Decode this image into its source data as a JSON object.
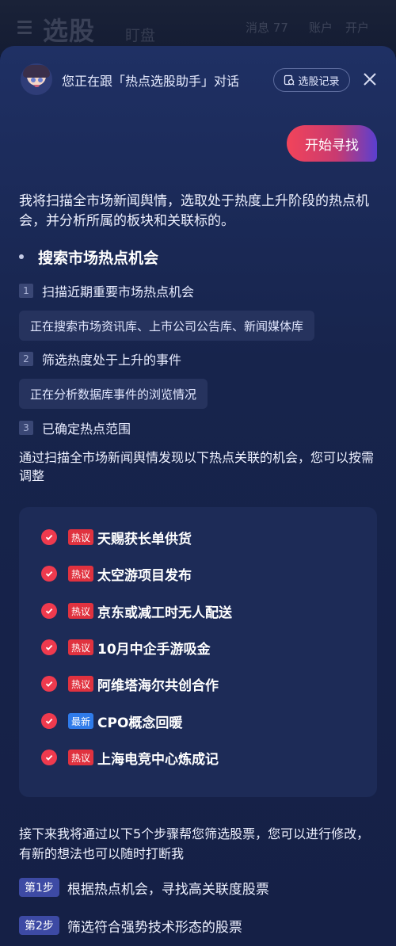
{
  "background_app": {
    "title": "选股",
    "subtitle": "盯盘",
    "messages_label": "消息",
    "messages_count": "77",
    "account_label": "账户",
    "open_label": "开户"
  },
  "header": {
    "title": "您正在跟「热点选股助手」对话",
    "history_label": "选股记录"
  },
  "user_message": "开始寻找",
  "assistant": {
    "intro": "我将扫描全市场新闻舆情，选取处于热度上升阶段的热点机会，并分析所属的板块和关联标的。",
    "section_title": "搜索市场热点机会",
    "steps": [
      {
        "num": "1",
        "text": "扫描近期重要市场热点机会",
        "note": "正在搜索市场资讯库、上市公司公告库、新闻媒体库"
      },
      {
        "num": "2",
        "text": "筛选热度处于上升的事件",
        "note": "正在分析数据库事件的浏览情况"
      },
      {
        "num": "3",
        "text": "已确定热点范围"
      }
    ],
    "summary": "通过扫描全市场新闻舆情发现以下热点关联的机会，您可以按需调整",
    "opportunities": [
      {
        "tag": "热议",
        "text": "天赐获长单供货"
      },
      {
        "tag": "热议",
        "text": "太空游项目发布"
      },
      {
        "tag": "热议",
        "text": "京东或减工时无人配送"
      },
      {
        "tag": "热议",
        "text": "10月中企手游吸金"
      },
      {
        "tag": "热议",
        "text": "阿维塔海尔共创合作"
      },
      {
        "tag": "最新",
        "text": "CPO概念回暖"
      },
      {
        "tag": "热议",
        "text": "上海电竞中心炼成记"
      }
    ],
    "next": "接下来我将通过以下5个步骤帮您筛选股票，您可以进行修改，有新的想法也可以随时打断我",
    "plan": [
      {
        "badge": "第1步",
        "text": "根据热点机会，寻找高关联度股票"
      },
      {
        "badge": "第2步",
        "text": "筛选符合强势技术形态的股票"
      }
    ]
  },
  "colors": {
    "accent_red": "#ef3a4e",
    "tag_hot": "#e0323f",
    "tag_new": "#2f7bea",
    "step_badge": "#3d4aa4"
  }
}
